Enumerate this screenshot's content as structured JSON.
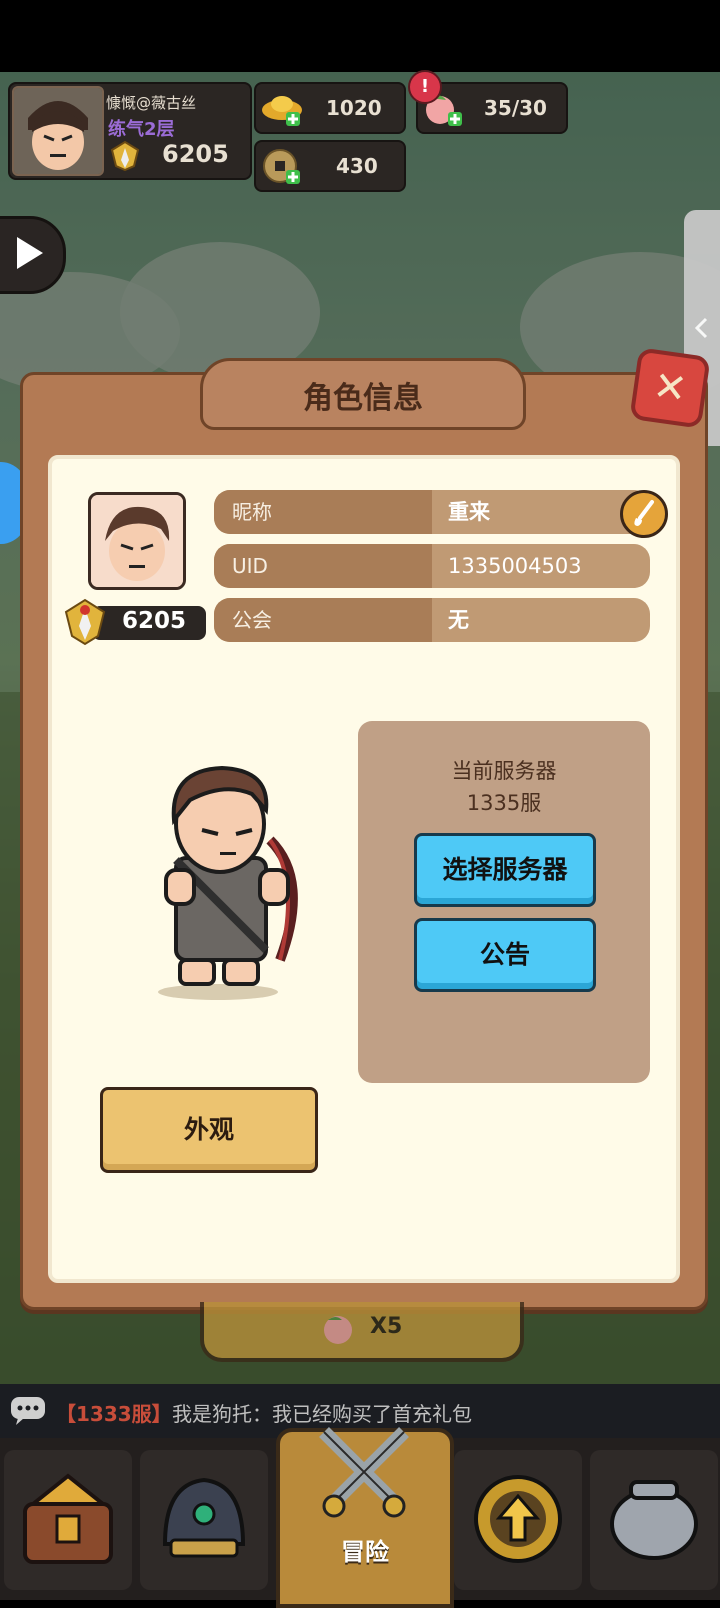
{
  "player": {
    "name": "慷慨@薇古丝",
    "realm": "练气2层",
    "power": "6205"
  },
  "currencies": {
    "gold": "1020",
    "peach_stamina": "35/30",
    "coins": "430"
  },
  "dialog": {
    "title": "角色信息",
    "close_label": "✕",
    "power": "6205",
    "rows": [
      {
        "label": "昵称",
        "value": "重来"
      },
      {
        "label": "UID",
        "value": "1335004503"
      },
      {
        "label": "公会",
        "value": "无"
      }
    ],
    "server": {
      "heading": "当前服务器",
      "current": "1335服",
      "select_label": "选择服务器",
      "notice_label": "公告"
    },
    "appearance_label": "外观"
  },
  "below_dialog": {
    "reward_text": "X5"
  },
  "chat": {
    "server_tag": "【1333服】",
    "message": "我是狗托：我已经购买了首充礼包"
  },
  "nav": {
    "adventure_label": "冒险"
  },
  "side_tab_icon": "chevron-left-icon",
  "colors": {
    "accent_blue": "#4ec9f6",
    "button_gold": "#ecc370",
    "close_red": "#d8473f",
    "realm_purple": "#9b6cd6",
    "chat_tag_red": "#c84d3a"
  }
}
